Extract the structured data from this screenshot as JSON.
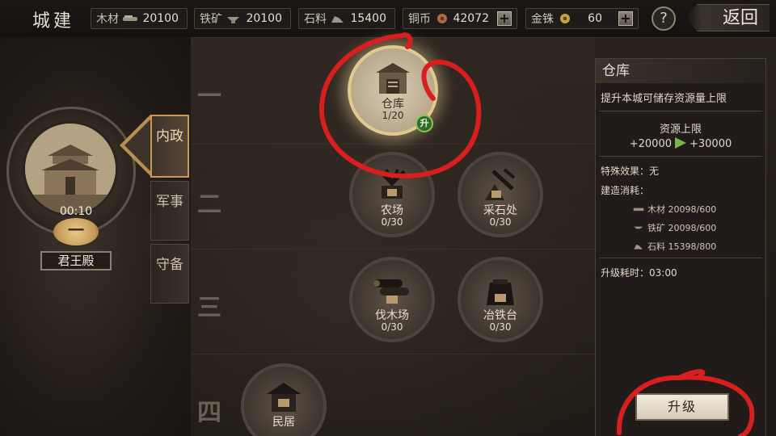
{
  "header": {
    "title": "城建",
    "resources": [
      {
        "label": "木材",
        "value": "20100",
        "icon": "wood-icon"
      },
      {
        "label": "铁矿",
        "value": "20100",
        "icon": "iron-icon"
      },
      {
        "label": "石料",
        "value": "15400",
        "icon": "stone-icon"
      },
      {
        "label": "铜币",
        "value": "42072",
        "icon": "copper-coin-icon"
      },
      {
        "label": "金铢",
        "value": "60",
        "icon": "gold-coin-icon"
      }
    ],
    "plus_label": "+",
    "help_label": "?",
    "back_label": "返回"
  },
  "left": {
    "palace_timer": "00:10",
    "palace_level": "一",
    "palace_name": "君王殿",
    "tabs": [
      {
        "label": "内政",
        "active": true
      },
      {
        "label": "军事",
        "active": false
      },
      {
        "label": "守备",
        "active": false
      }
    ]
  },
  "tiers": [
    "一",
    "二",
    "三",
    "四"
  ],
  "buildings": [
    {
      "name": "仓库",
      "count": "1/20",
      "icon": "warehouse-icon",
      "selected": true,
      "upgrade_badge": "升"
    },
    {
      "name": "农场",
      "count": "0/30",
      "icon": "farm-icon"
    },
    {
      "name": "采石处",
      "count": "0/30",
      "icon": "quarry-icon"
    },
    {
      "name": "伐木场",
      "count": "0/30",
      "icon": "lumber-icon"
    },
    {
      "name": "冶铁台",
      "count": "0/30",
      "icon": "smelter-icon"
    },
    {
      "name": "民居",
      "count": "",
      "icon": "house-icon"
    }
  ],
  "detail": {
    "title": "仓库",
    "description": "提升本城可储存资源量上限",
    "cap_label": "资源上限",
    "cap_from": "+20000",
    "cap_to": "+30000",
    "special_effect": "特殊效果：无",
    "build_cost_label": "建造消耗：",
    "costs": [
      {
        "text": "木材 20098/600",
        "icon": "wood-icon"
      },
      {
        "text": "铁矿 20098/600",
        "icon": "iron-icon"
      },
      {
        "text": "石料 15398/800",
        "icon": "stone-icon"
      }
    ],
    "upgrade_time": "升级耗时：03:00",
    "upgrade_button": "升级"
  },
  "colors": {
    "annotation": "#d81e1e",
    "accent_gold": "#c79a56",
    "green_badge": "#2f6a2a"
  }
}
